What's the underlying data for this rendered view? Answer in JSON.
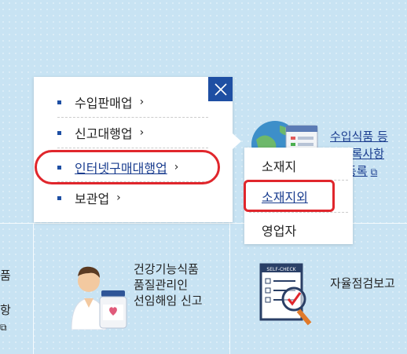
{
  "menu": {
    "items": [
      {
        "label": "수입판매업"
      },
      {
        "label": "신고대행업"
      },
      {
        "label": "인터넷구매대행업"
      },
      {
        "label": "보관업"
      }
    ],
    "close_label": "×"
  },
  "submenu": {
    "items": [
      {
        "label": "소재지"
      },
      {
        "label": "소재지외"
      },
      {
        "label": "영업자"
      }
    ]
  },
  "background": {
    "right_card_lines": [
      "수입식품 등",
      "입등록사항",
      "등록"
    ],
    "health_lines": [
      "건강기능식품",
      "품질관리인",
      "선임해임 신고"
    ],
    "check_label": "자율점검보고",
    "check_icon_label": "SELF-CHECK",
    "left_cut": [
      "품",
      "항"
    ]
  },
  "colors": {
    "accent": "#1e4fa3",
    "highlight": "#e0262c",
    "background": "#c8e3f3"
  }
}
